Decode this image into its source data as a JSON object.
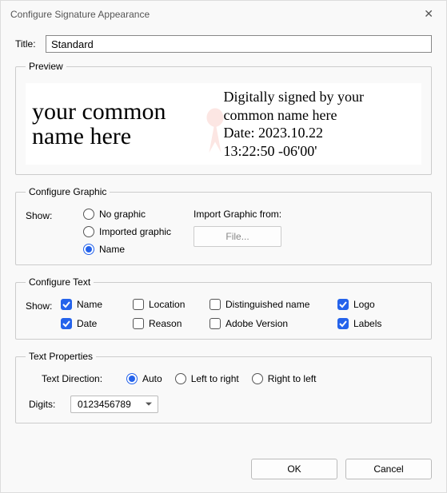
{
  "window": {
    "title": "Configure Signature Appearance"
  },
  "titleRow": {
    "label": "Title:",
    "value": "Standard"
  },
  "preview": {
    "legend": "Preview",
    "leftText": "your common\nname here",
    "rightText": "Digitally signed by your\ncommon name here\nDate: 2023.10.22\n13:22:50 -06'00'"
  },
  "graphic": {
    "legend": "Configure Graphic",
    "showLabel": "Show:",
    "options": {
      "noGraphic": "No graphic",
      "importedGraphic": "Imported graphic",
      "name": "Name"
    },
    "selected": "name",
    "importLabel": "Import Graphic from:",
    "fileButton": "File..."
  },
  "text": {
    "legend": "Configure Text",
    "showLabel": "Show:",
    "items": {
      "name": {
        "label": "Name",
        "checked": true
      },
      "location": {
        "label": "Location",
        "checked": false
      },
      "distinguished": {
        "label": "Distinguished name",
        "checked": false
      },
      "logo": {
        "label": "Logo",
        "checked": true
      },
      "date": {
        "label": "Date",
        "checked": true
      },
      "reason": {
        "label": "Reason",
        "checked": false
      },
      "adobe": {
        "label": "Adobe Version",
        "checked": false
      },
      "labels": {
        "label": "Labels",
        "checked": true
      }
    }
  },
  "props": {
    "legend": "Text Properties",
    "dirLabel": "Text Direction:",
    "dir": {
      "auto": "Auto",
      "ltr": "Left to right",
      "rtl": "Right to left"
    },
    "dirSelected": "auto",
    "digitsLabel": "Digits:",
    "digitsValue": "0123456789"
  },
  "footer": {
    "ok": "OK",
    "cancel": "Cancel"
  }
}
